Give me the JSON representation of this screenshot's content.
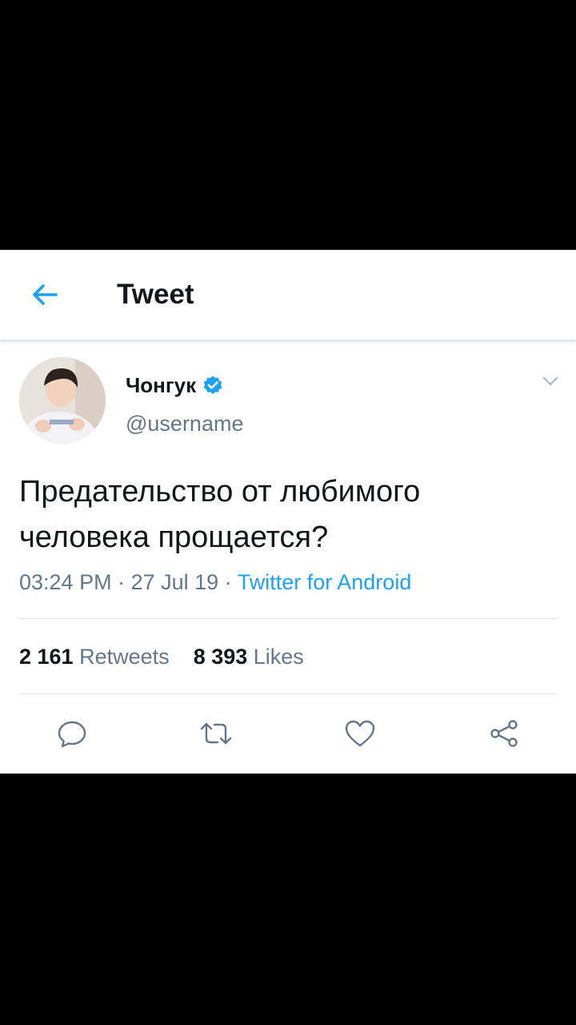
{
  "header": {
    "title": "Tweet",
    "back_icon": "arrow-left-icon",
    "accent_color": "#1da1f2"
  },
  "tweet": {
    "author_name": "Чонгук",
    "author_handle": "@username",
    "verified": true,
    "text_line1": "Предательство от любимого",
    "text_line2": "человека прощается?",
    "time": "03:24 PM",
    "separator": "·",
    "date": "27 Jul 19",
    "source": "Twitter for Android",
    "retweets_count": "2 161",
    "retweets_label": "Retweets",
    "likes_count": "8 393",
    "likes_label": "Likes"
  },
  "actions": {
    "reply_icon": "reply-icon",
    "retweet_icon": "retweet-icon",
    "like_icon": "heart-icon",
    "share_icon": "share-icon"
  },
  "colors": {
    "background_outer": "#000000",
    "card": "#ffffff",
    "text_primary": "#14171a",
    "text_secondary": "#657786",
    "link": "#1da1f2",
    "divider": "#e1e8ed"
  }
}
